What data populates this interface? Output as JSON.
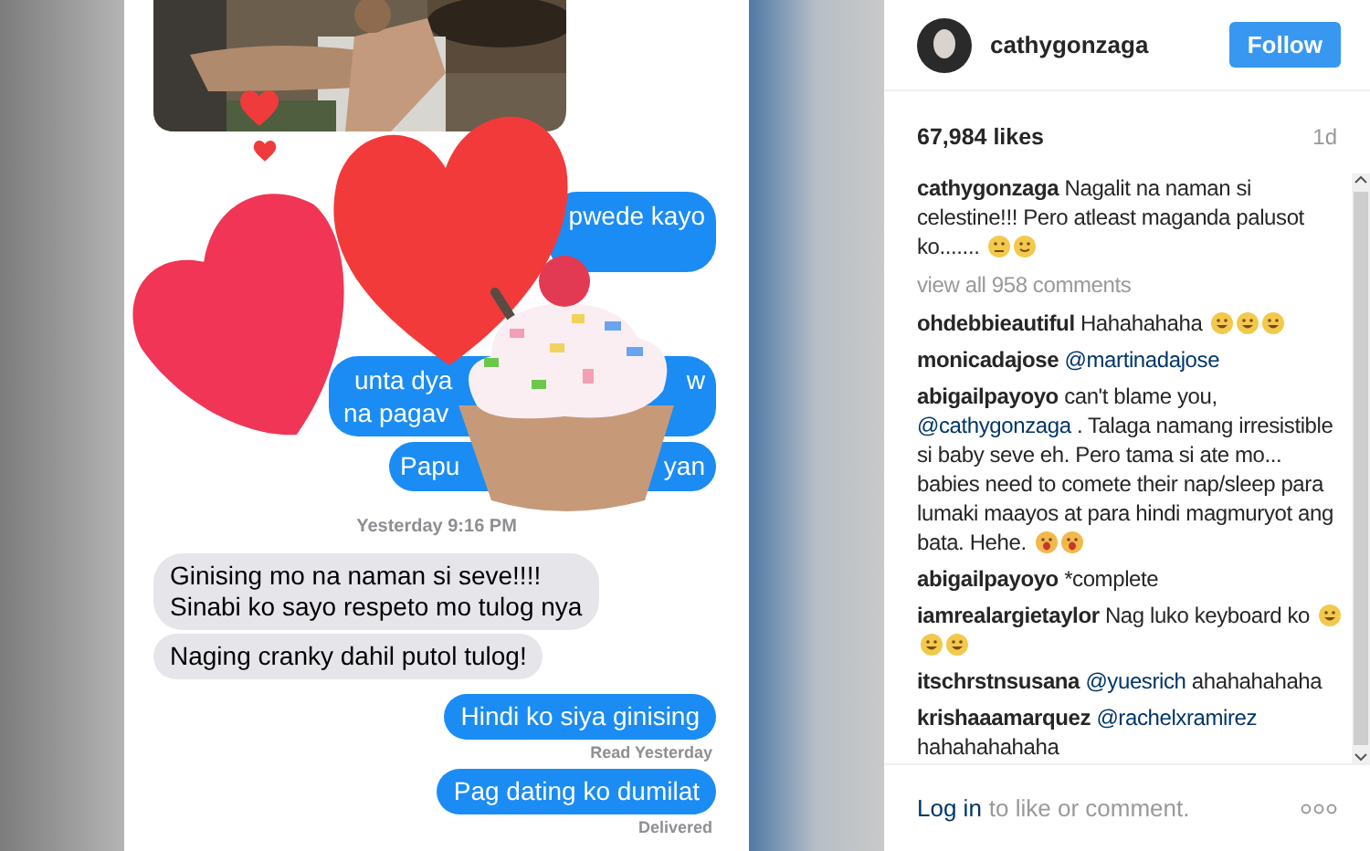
{
  "post_image": {
    "chat": {
      "bubbles": [
        {
          "kind": "sent",
          "frags": [
            "pwede kayo"
          ]
        },
        {
          "kind": "sent",
          "frags": [
            "unta dya",
            "w",
            "na pagav"
          ]
        },
        {
          "kind": "sent",
          "frags": [
            "Papu",
            "yan"
          ]
        }
      ],
      "timestamp": "Yesterday 9:16 PM",
      "messages": [
        {
          "kind": "received",
          "text": "Ginising mo na naman si seve!!!!\nSinabi ko sayo respeto mo tulog nya"
        },
        {
          "kind": "received",
          "text": "Naging cranky dahil putol tulog!"
        },
        {
          "kind": "sent",
          "text": "Hindi ko siya ginising",
          "status": "Read Yesterday"
        },
        {
          "kind": "sent",
          "text": "Pag dating ko dumilat",
          "status": "Delivered"
        }
      ]
    }
  },
  "post": {
    "username": "cathygonzaga",
    "follow_button": "Follow",
    "likes": "67,984 likes",
    "age": "1d",
    "caption": {
      "user": "cathygonzaga",
      "parts": [
        {
          "kind": "text",
          "text": "Nagalit na naman si celestine!!! Pero atleast maganda palusot ko......."
        }
      ],
      "emojis": [
        {
          "kind": "worried"
        },
        {
          "kind": "smile"
        }
      ]
    },
    "view_all": "view all 958 comments",
    "comments": [
      {
        "user": "ohdebbieautiful",
        "parts": [
          {
            "kind": "text",
            "text": "Hahahahaha"
          }
        ],
        "emojis": [
          {
            "kind": "laugh"
          },
          {
            "kind": "laugh"
          },
          {
            "kind": "laugh"
          }
        ]
      },
      {
        "user": "monicadajose",
        "parts": [
          {
            "kind": "mention",
            "text": "@martinadajose"
          }
        ]
      },
      {
        "user": "abigailpayoyo",
        "parts": [
          {
            "kind": "text",
            "text": "can't blame you,"
          },
          {
            "kind": "mention",
            "text": "@cathygonzaga"
          },
          {
            "kind": "text",
            "text": ". Talaga namang irresistible si baby seve eh. Pero tama si ate mo... babies need to comete their nap/sleep para lumaki maayos at para hindi magmuryot ang bata. Hehe."
          }
        ],
        "emojis": [
          {
            "kind": "wow"
          },
          {
            "kind": "wow"
          }
        ]
      },
      {
        "user": "abigailpayoyo",
        "parts": [
          {
            "kind": "text",
            "text": "*complete"
          }
        ]
      },
      {
        "user": "iamrealargietaylor",
        "parts": [
          {
            "kind": "text",
            "text": "Nag luko keyboard ko"
          }
        ],
        "emojis": [
          {
            "kind": "laugh"
          },
          {
            "kind": "laugh"
          },
          {
            "kind": "laugh"
          }
        ]
      },
      {
        "user": "itschrstnsusana",
        "parts": [
          {
            "kind": "mention",
            "text": "@yuesrich"
          },
          {
            "kind": "text",
            "text": "ahahahahaha"
          }
        ]
      },
      {
        "user": "krishaaamarquez",
        "parts": [
          {
            "kind": "mention",
            "text": "@rachelxramirez"
          },
          {
            "kind": "text",
            "text": "hahahahahaha"
          }
        ]
      }
    ],
    "login_link": "Log in",
    "login_text": "to like or comment."
  }
}
